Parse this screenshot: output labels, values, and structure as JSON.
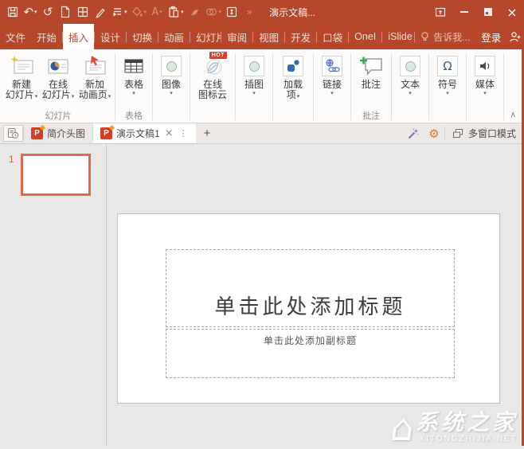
{
  "glyphs": {
    "undo": "↶",
    "redo": "↺",
    "more": "»",
    "dropdown": "▾",
    "collapse": "∧",
    "omega": "Ω",
    "gear": "⚙",
    "kebab": "⋮",
    "close_tab": "×",
    "new_tab": "+",
    "overflow": "▸",
    "close_window": "×",
    "font_color": "A",
    "house": "⌂",
    "ppt_letter": "P"
  },
  "titlebar": {
    "title": "演示文稿..."
  },
  "menubar": {
    "tabs": [
      {
        "label": "文件"
      },
      {
        "label": "开始"
      },
      {
        "label": "插入"
      },
      {
        "label": "设计"
      },
      {
        "label": "切换"
      },
      {
        "label": "动画"
      },
      {
        "label": "幻灯片"
      },
      {
        "label": "审阅"
      },
      {
        "label": "视图"
      },
      {
        "label": "开发"
      },
      {
        "label": "口袋"
      },
      {
        "label": "OneI"
      },
      {
        "label": "iSlide"
      }
    ],
    "tell_me": "告诉我...",
    "sign_in": "登录",
    "share": "共"
  },
  "ribbon": {
    "groups": [
      {
        "label": "幻灯片",
        "buttons": [
          {
            "line1": "新建",
            "line2": "幻灯片"
          },
          {
            "line1": "在线",
            "line2": "幻灯片"
          },
          {
            "line1": "新加",
            "line2": "动画页"
          }
        ]
      },
      {
        "label": "表格",
        "buttons": [
          {
            "line1": "表格"
          }
        ]
      },
      {
        "label": "",
        "buttons": [
          {
            "line1": "图像"
          }
        ]
      },
      {
        "label": "",
        "buttons": [
          {
            "line1": "在线",
            "line2": "图标云",
            "badge": "HOT"
          }
        ]
      },
      {
        "label": "",
        "buttons": [
          {
            "line1": "插图"
          }
        ]
      },
      {
        "label": "",
        "buttons": [
          {
            "line1": "加载",
            "line2": "项"
          }
        ]
      },
      {
        "label": "",
        "buttons": [
          {
            "line1": "链接"
          }
        ]
      },
      {
        "label": "批注",
        "buttons": [
          {
            "line1": "批注"
          }
        ]
      },
      {
        "label": "",
        "buttons": [
          {
            "line1": "文本"
          }
        ]
      },
      {
        "label": "",
        "buttons": [
          {
            "line1": "符号"
          }
        ]
      },
      {
        "label": "",
        "buttons": [
          {
            "line1": "媒体"
          }
        ]
      }
    ]
  },
  "doctabs": {
    "tabs": [
      {
        "label": "简介头图"
      },
      {
        "label": "演示文稿1"
      }
    ],
    "multi_window": "多窗口模式"
  },
  "slide_panel": {
    "slide_number": "1"
  },
  "slide": {
    "title_placeholder": "单击此处添加标题",
    "subtitle_placeholder": "单击此处添加副标题"
  },
  "watermark": {
    "name": "系统之家",
    "site": "XITONGZHIJIA.NET"
  }
}
